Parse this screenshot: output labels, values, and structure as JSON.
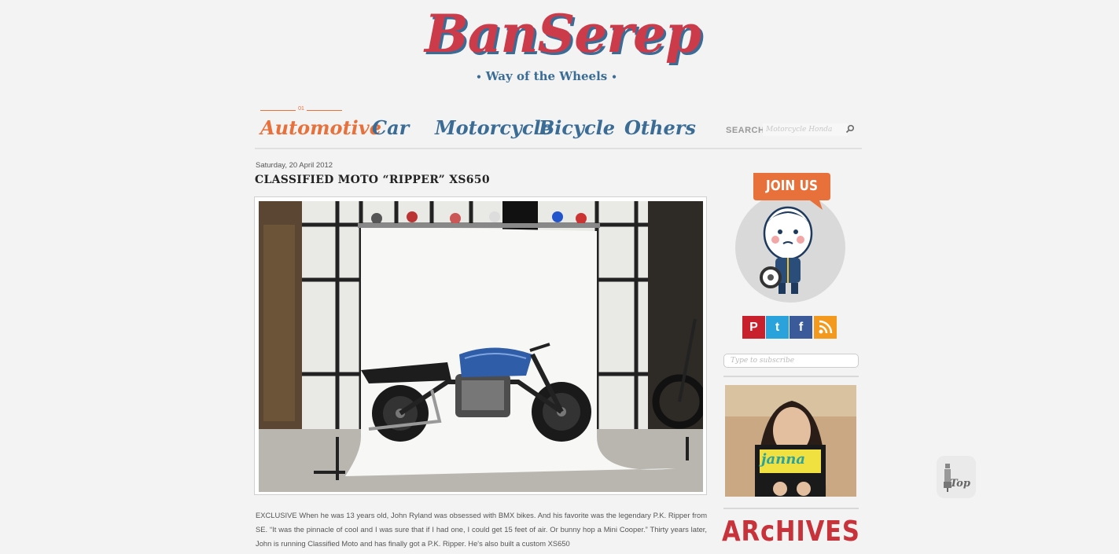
{
  "logo": {
    "name": "BanSerep",
    "tagline": "Way of the Wheels",
    "tag_dot": "•"
  },
  "nav": {
    "active_number": "01",
    "items": [
      {
        "label": "Automotive",
        "active": true
      },
      {
        "label": "Car"
      },
      {
        "label": "Motorcycle"
      },
      {
        "label": "Bicycle"
      },
      {
        "label": "Others"
      }
    ]
  },
  "search": {
    "label": "SEARCH",
    "placeholder": "Motorcycle Honda",
    "icon": "search-icon"
  },
  "post": {
    "date": "Saturday, 20 April 2012",
    "title": "CLASSIFIED MOTO “RIPPER” XS650",
    "body": "EXCLUSIVE When he was 13 years old, John Ryland was obsessed with BMX bikes. And his favorite was the legendary P.K. Ripper from SE. “It was the pinnacle of cool and I was sure that if I had one, I could get 15 feet of air. Or bunny hop a Mini Cooper.” Thirty years later, John is running Classified Moto and has finally got a P.K. Ripper. He's also built a custom XS650"
  },
  "sidebar": {
    "join_label": "JOIN US",
    "social": [
      {
        "name": "pinterest-icon",
        "glyph": "P",
        "color": "#c8202d"
      },
      {
        "name": "twitter-icon",
        "glyph": "t",
        "color": "#2aa3dd"
      },
      {
        "name": "facebook-icon",
        "glyph": "f",
        "color": "#3b5a9a"
      },
      {
        "name": "rss-icon",
        "glyph": ")",
        "color": "#f39a1e"
      }
    ],
    "subscribe_placeholder": "Type to subscribe",
    "ad_text": "janna",
    "archives_label": "ARcHIVES"
  },
  "top_button": {
    "label": "Top"
  },
  "colors": {
    "brand_red": "#cc3b4a",
    "brand_blue": "#3a6c96",
    "nav_active": "#e8703a",
    "archives": "#c8323a"
  }
}
